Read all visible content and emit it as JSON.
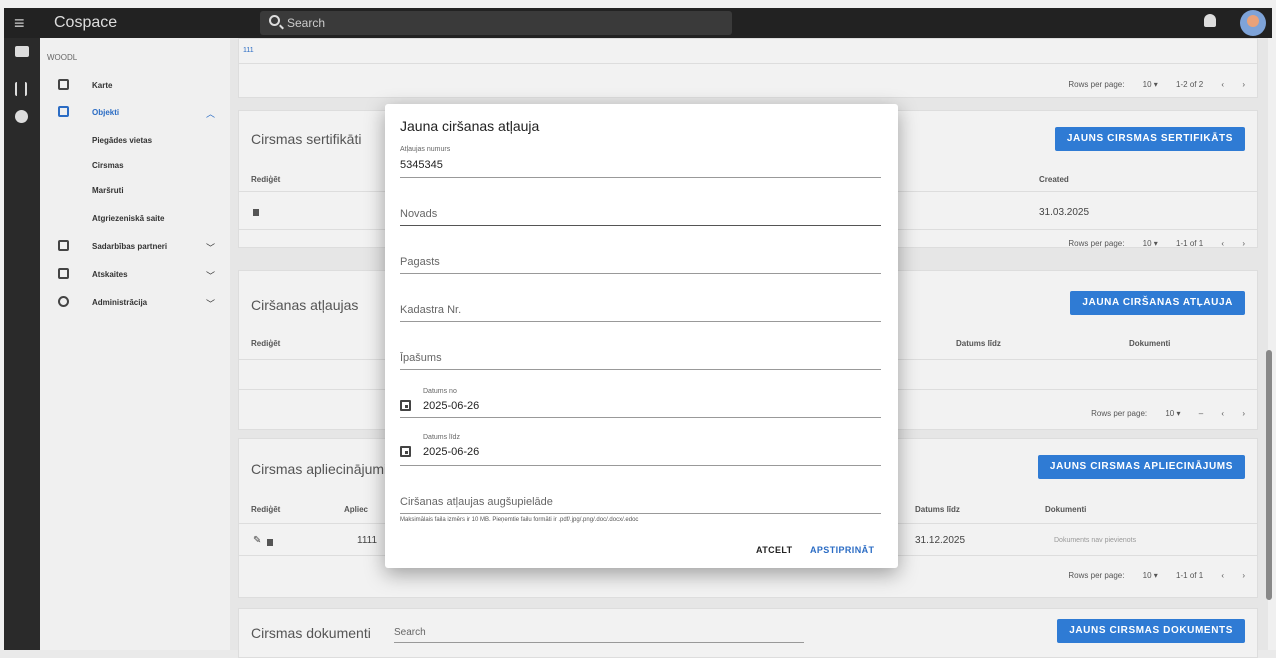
{
  "app": {
    "title": "Cospace",
    "search_placeholder": "Search"
  },
  "sidebar": {
    "org": "WOODL",
    "items": [
      {
        "label": "Karte",
        "icon": "map-icon"
      },
      {
        "label": "Objekti",
        "icon": "objects-icon",
        "chev": "^"
      },
      {
        "label": "Sadarbības partneri",
        "icon": "partners-icon",
        "chev": "v"
      },
      {
        "label": "Atskaites",
        "icon": "reports-icon",
        "chev": "v"
      },
      {
        "label": "Administrācija",
        "icon": "admin-icon",
        "chev": "v"
      }
    ],
    "sub": [
      "Piegādes vietas",
      "Cirsmas",
      "Maršruti",
      "Atgriezeniskā saite"
    ]
  },
  "top_card": {
    "link": "111",
    "rows_per_page": "Rows per page:",
    "rpp": "10",
    "range": "1-2 of 2"
  },
  "cert": {
    "title": "Cirsmas sertifikāti",
    "btn": "JAUNS CIRSMAS SERTIFIKĀTS",
    "h_edit": "Rediģēt",
    "h_created": "Created",
    "created": "31.03.2025",
    "rows_per_page": "Rows per page:",
    "rpp": "10",
    "range": "1-1 of 1"
  },
  "permits": {
    "title": "Ciršanas atļaujas",
    "btn": "JAUNA CIRŠANAS ATĻAUJA",
    "h_edit": "Rediģēt",
    "h_until": "Datums līdz",
    "h_docs": "Dokumenti",
    "rows_per_page": "Rows per page:",
    "rpp": "10",
    "range": "–"
  },
  "approvals": {
    "title": "Cirsmas apliecinājumi",
    "btn": "JAUNS CIRSMAS APLIECINĀJUMS",
    "h_edit": "Rediģēt",
    "h_apl": "Apliec",
    "h_until": "Datums līdz",
    "h_docs": "Dokumenti",
    "num": "1111",
    "until": "31.12.2025",
    "docs": "Dokuments nav pievienots",
    "rows_per_page": "Rows per page:",
    "rpp": "10",
    "range": "1-1 of 1"
  },
  "docs": {
    "title": "Cirsmas dokumenti",
    "search": "Search",
    "btn": "JAUNS CIRSMAS DOKUMENTS"
  },
  "dialog": {
    "title": "Jauna ciršanas atļauja",
    "permit_label": "Atļaujas numurs",
    "permit_value": "5345345",
    "novads": "Novads",
    "pagasts": "Pagasts",
    "kadastrs": "Kadastra Nr.",
    "ipasums": "Īpašums",
    "from_label": "Datums no",
    "from_value": "2025-06-26",
    "to_label": "Datums līdz",
    "to_value": "2025-06-26",
    "upload": "Ciršanas atļaujas augšupielāde",
    "hint": "Maksimālais faila izmērs ir 10 MB. Pieņemtie failu formāti ir .pdf/.jpg/.png/.doc/.docx/.edoc",
    "cancel": "ATCELT",
    "confirm": "APSTIPRINĀT"
  }
}
